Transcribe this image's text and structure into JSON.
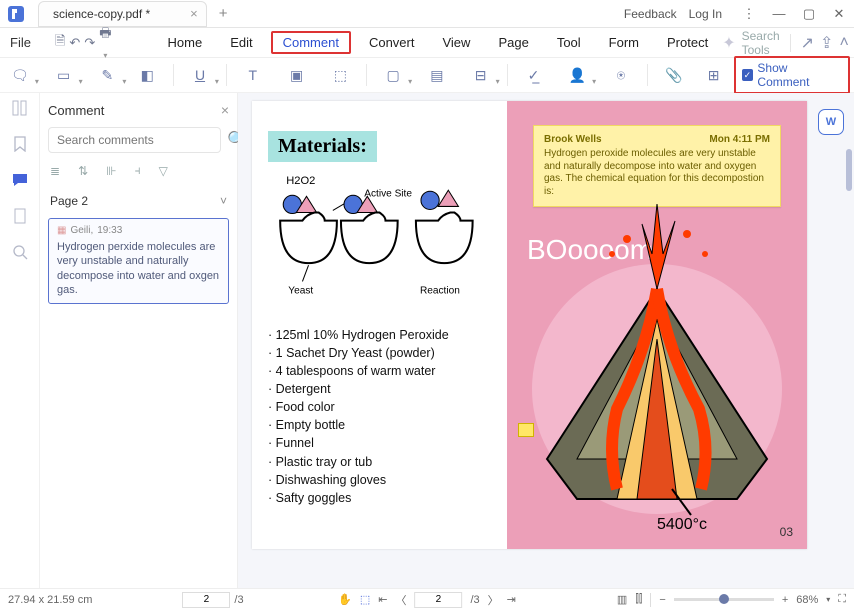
{
  "titlebar": {
    "tab_name": "science-copy.pdf *",
    "feedback": "Feedback",
    "login": "Log In"
  },
  "menu": {
    "file": "File",
    "tabs": [
      "Home",
      "Edit",
      "Comment",
      "Convert",
      "View",
      "Page",
      "Tool",
      "Form",
      "Protect"
    ],
    "active": "Comment",
    "search_placeholder": "Search Tools"
  },
  "ribbon": {
    "show_comment": "Show Comment"
  },
  "comment_panel": {
    "title": "Comment",
    "search_placeholder": "Search comments",
    "page_label": "Page 2",
    "item": {
      "author": "Geili,",
      "time": "19:33",
      "text": "Hydrogen perxide molecules are very unstable and naturally decompose into water and oxgen gas."
    }
  },
  "page": {
    "materials_heading": "Materials:",
    "diagram_labels": {
      "h2o2": "H2O2",
      "active_site": "Active Site",
      "yeast": "Yeast",
      "reaction": "Reaction"
    },
    "materials": [
      "125ml 10% Hydrogen Peroxide",
      "1 Sachet Dry Yeast (powder)",
      "4 tablespoons of warm water",
      "Detergent",
      "Food color",
      "Empty bottle",
      "Funnel",
      "Plastic tray or tub",
      "Dishwashing gloves",
      "Safty goggles"
    ],
    "illustration": {
      "boom": "BOoooom!",
      "temp": "5400°c"
    },
    "page_number": "03",
    "sticky": {
      "author": "Brook Wells",
      "when": "Mon 4:11 PM",
      "body": "Hydrogen peroxide molecules are very unstable and naturally decompose into water and oxygen gas. The chemical equation for this decompostion is:"
    }
  },
  "status": {
    "dims": "27.94 x 21.59 cm",
    "page_current": "2",
    "page_total": "/3",
    "zoom": "68%"
  }
}
